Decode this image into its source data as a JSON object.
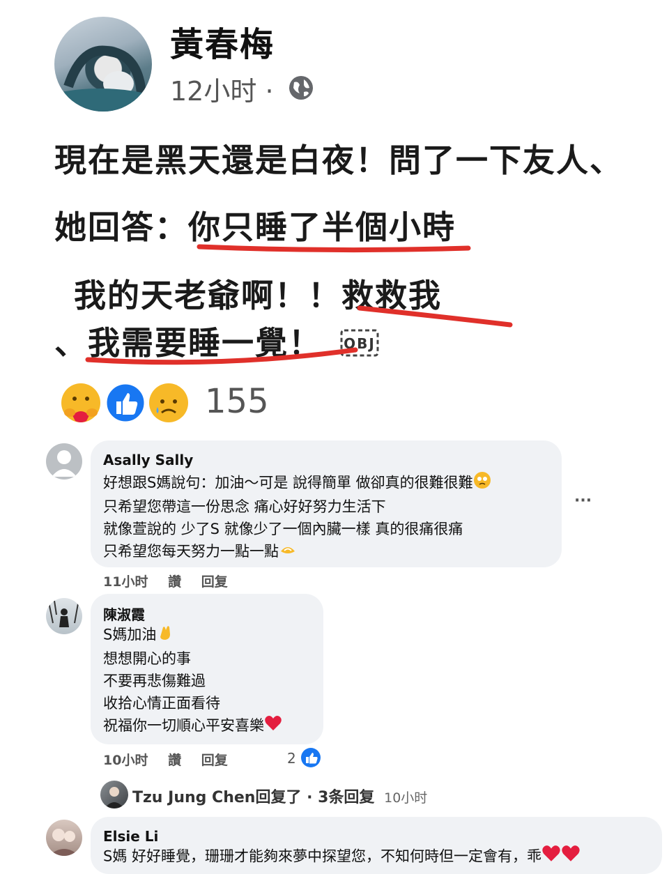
{
  "post": {
    "author": "黃春梅",
    "time": "12小时",
    "separator": "·",
    "lines": [
      "現在是黑天還是白夜！問了一下友人、",
      "她回答：你只睡了半個小時",
      "我的天老爺啊！！救救我",
      "、我需要睡一覺！"
    ],
    "reactions_count": "155",
    "icons": [
      "globe-icon",
      "care-reaction-icon",
      "like-reaction-icon",
      "sad-reaction-icon"
    ],
    "underline_color": "#e0302a"
  },
  "comments": [
    {
      "name": "Asally Sally",
      "lines": [
        "好想跟S媽說句：加油～可是 說得簡單 做卻真的很難很難",
        "只希望您帶這一份思念 痛心好好努力生活下",
        "就像萱說的 少了S 就像少了一個內臟一樣 真的很痛很痛",
        "只希望您每天努力一點一點"
      ],
      "time": "11小时",
      "like": "讚",
      "reply": "回复",
      "more": "···"
    },
    {
      "name": "陳淑霞",
      "lines": [
        "S媽加油",
        "想想開心的事",
        "不要再悲傷難過",
        "收拾心情正面看待",
        "祝福你一切順心平安喜樂"
      ],
      "time": "10小时",
      "like": "讚",
      "reply": "回复",
      "likes": "2"
    },
    {
      "name": "Elsie Li",
      "lines": [
        "S媽 好好睡覺，珊珊才能夠來夢中探望您，不知何時但一定會有，乖"
      ]
    }
  ],
  "reply_summary": {
    "name": "Tzu Jung Chen",
    "text": "回复了 · 3条回复",
    "time": "10小时"
  },
  "colors": {
    "facebook_blue": "#1877f2",
    "bubble": "#f0f2f5",
    "heart": "#e41e3f"
  }
}
